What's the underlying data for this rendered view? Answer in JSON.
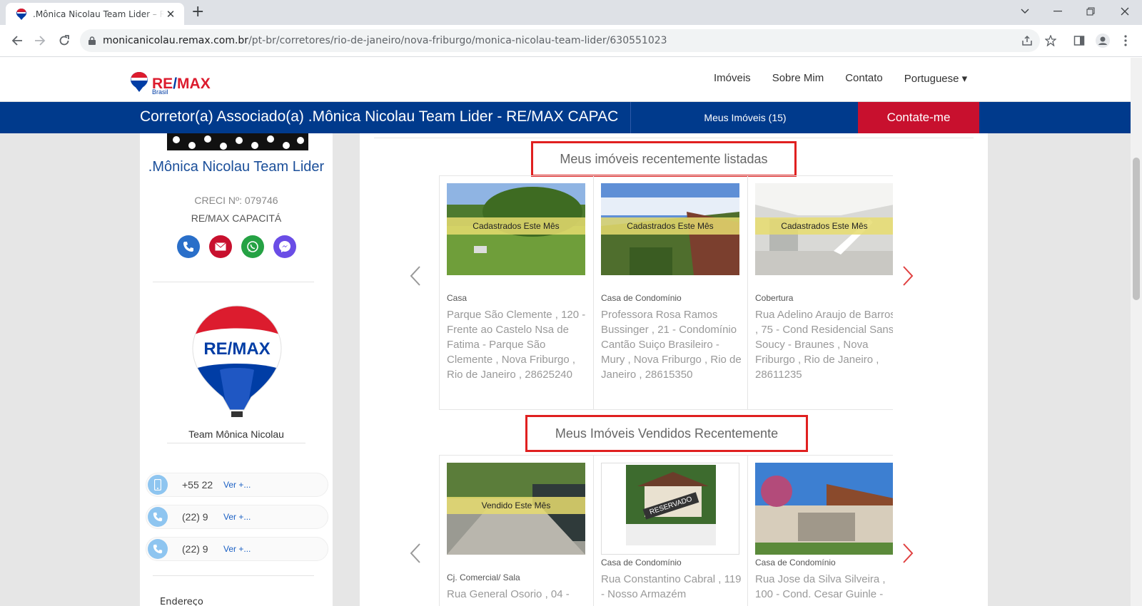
{
  "browser": {
    "tab_title": ".Mônica Nicolau Team Lider – RE/MAX",
    "url_host": "monicanicolau.remax.com.br",
    "url_path": "/pt-br/corretores/rio-de-janeiro/nova-friburgo/monica-nicolau-team-lider/630551023",
    "new_tab_symbol": "+",
    "close_symbol": "✕"
  },
  "header": {
    "logo_text_re": "RE",
    "logo_text_slash": "/",
    "logo_text_max": "MAX",
    "logo_sub": "Brasil",
    "nav": [
      "Imóveis",
      "Sobre Mim",
      "Contato",
      "Portuguese ▾"
    ]
  },
  "bluebar": {
    "heading": "Corretor(a) Associado(a) .Mônica Nicolau Team Lider - RE/MAX CAPACITÁ",
    "my_properties": "Meus Imóveis (15)",
    "contact_button": "Contate-me"
  },
  "sidebar": {
    "agent_name": ".Mônica Nicolau Team Lider",
    "creci": "CRECI Nº: 079746",
    "office": "RE/MAX CAPACITÁ",
    "social_icons": [
      "phone-icon",
      "email-icon",
      "whatsapp-icon",
      "messenger-icon"
    ],
    "balloon_text": "RE/MAX",
    "team_name": "Team Mônica Nicolau",
    "phones": [
      {
        "icon": "mobile-icon",
        "number": "+55 22",
        "more": "Ver +..."
      },
      {
        "icon": "phone-icon",
        "number": "(22) 9",
        "more": "Ver +..."
      },
      {
        "icon": "phone-icon",
        "number": "(22) 9",
        "more": "Ver +..."
      }
    ],
    "tail_text": "Endereço"
  },
  "listed": {
    "title": "Meus imóveis recentemente listadas",
    "cards": [
      {
        "ribbon": "Cadastrados Este Mês",
        "type": "Casa",
        "address": "Parque São Clemente , 120 - Frente ao Castelo Nsa de Fatima - Parque São Clemente , Nova Friburgo , Rio de Janeiro , 28625240"
      },
      {
        "ribbon": "Cadastrados Este Mês",
        "type": "Casa de Condomínio",
        "address": "Professora Rosa Ramos Bussinger , 21 - Condomínio Cantão Suiço Brasileiro - Mury , Nova Friburgo , Rio de Janeiro , 28615350"
      },
      {
        "ribbon": "Cadastrados Este Mês",
        "type": "Cobertura",
        "address": "Rua Adelino Araujo de Barros , 75 - Cond Residencial Sans Soucy - Braunes , Nova Friburgo , Rio de Janeiro , 28611235"
      }
    ]
  },
  "sold": {
    "title": "Meus Imóveis Vendidos Recentemente",
    "cards": [
      {
        "ribbon": "Vendido Este Mês",
        "type": "Cj. Comercial/ Sala",
        "address": "Rua General Osorio , 04 -"
      },
      {
        "ribbon": "",
        "stamp": "RESERVADO",
        "type": "Casa de Condomínio",
        "address": "Rua Constantino Cabral , 119 - Nosso Armazém"
      },
      {
        "ribbon": "",
        "type": "Casa de Condomínio",
        "address": "Rua Jose da Silva Silveira , 100 - Cond. Cesar Guinle -"
      }
    ]
  },
  "colors": {
    "brand_blue": "#003a8c",
    "brand_red": "#c8102e",
    "highlight_border": "#e02020",
    "arrow_red": "#e04040"
  }
}
